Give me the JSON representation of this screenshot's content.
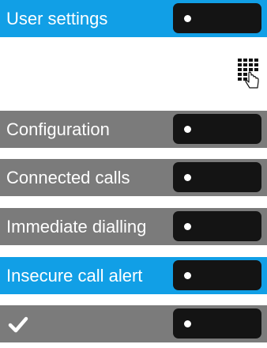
{
  "colors": {
    "selected": "#119fe6",
    "normal": "#7b7b7b",
    "key": "#141414"
  },
  "icons": {
    "keypad": "keypad-hand-icon",
    "check": "check-icon",
    "key_led": "dot-icon"
  },
  "rows": [
    {
      "label": "User settings",
      "selected": true
    },
    {
      "label": "Configuration",
      "selected": false
    },
    {
      "label": "Connected calls",
      "selected": false
    },
    {
      "label": "Immediate dialling",
      "selected": false
    },
    {
      "label": "Insecure call alert",
      "selected": true
    },
    {
      "label": "",
      "selected": false,
      "icon": "check-icon"
    }
  ]
}
